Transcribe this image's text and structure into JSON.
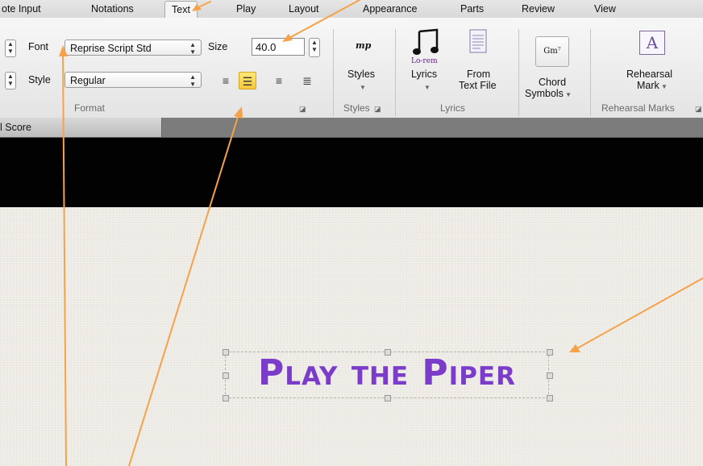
{
  "tabs": [
    "ote Input",
    "Notations",
    "Text",
    "Play",
    "Layout",
    "Appearance",
    "Parts",
    "Review",
    "View"
  ],
  "format": {
    "font_label": "Font",
    "font_value": "Reprise Script Std",
    "size_label": "Size",
    "size_value": "40.0",
    "style_label": "Style",
    "style_value": "Regular",
    "group_label": "Format",
    "alignment_selected": "center"
  },
  "styles": {
    "icon_text": "mp",
    "button_label": "Styles",
    "group_label": "Styles"
  },
  "lyrics": {
    "icon_text": "Lo-rem",
    "lyrics_label": "Lyrics",
    "from_label": "From",
    "text_file_label": "Text File",
    "group_label": "Lyrics"
  },
  "chord": {
    "icon_text": "Gm⁷",
    "label_line1": "Chord",
    "label_line2": "Symbols"
  },
  "rehearsal": {
    "icon_text": "A",
    "label_line1": "Rehearsal",
    "label_line2": "Mark",
    "group_label": "Rehearsal Marks"
  },
  "document": {
    "tab_label": "l Score",
    "title_text": "Play the Piper"
  },
  "colors": {
    "annotation_arrow": "#f5a24a",
    "title_purple": "#7a3cc9",
    "highlight": "#f5c93a"
  }
}
